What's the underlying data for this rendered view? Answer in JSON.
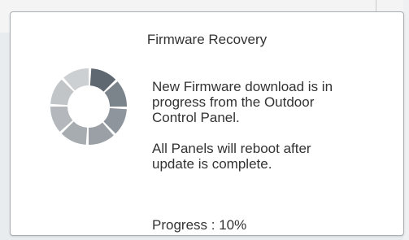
{
  "dialog": {
    "title": "Firmware Recovery",
    "message_lines": [
      "New Firmware download is in",
      "progress from the Outdoor",
      "Control Panel."
    ],
    "note_lines": [
      "All Panels will reboot after",
      "update is complete."
    ],
    "progress_text": "Progress : 10%",
    "progress_value": 0.1
  },
  "spinner": {
    "icon": "loading-spinner-icon",
    "colors": [
      "#5f6770",
      "#7b838b",
      "#8e959c",
      "#9aa0a6",
      "#a7acb1",
      "#b4b8bc",
      "#c1c5c8",
      "#cdd0d3"
    ]
  }
}
